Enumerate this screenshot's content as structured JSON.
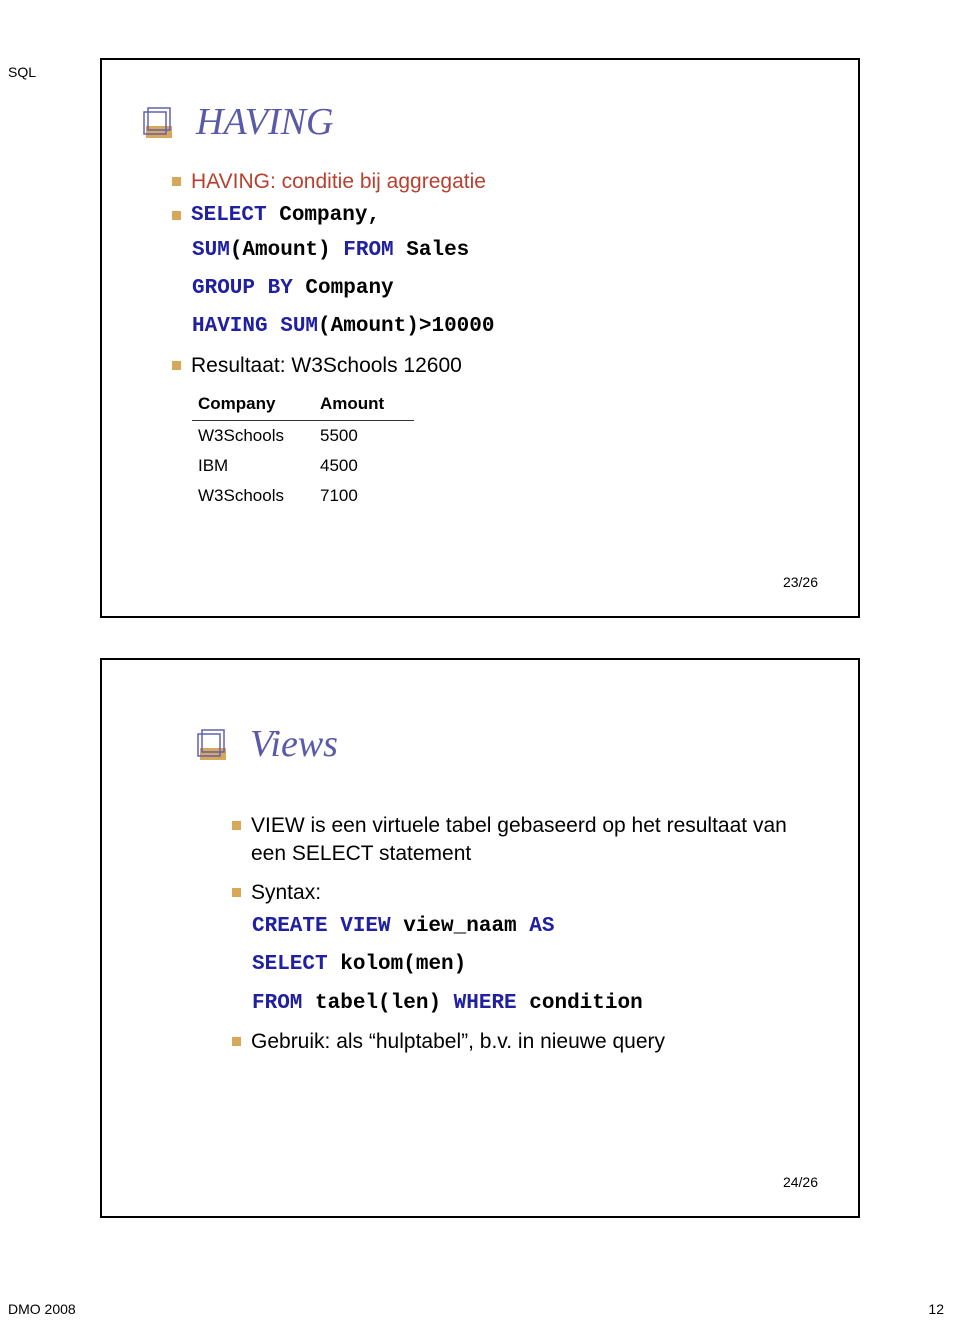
{
  "page_header": "SQL",
  "footer": {
    "left": "DMO 2008",
    "right": "12"
  },
  "slide1": {
    "title": "HAVING",
    "bullet_text": "HAVING: conditie bij aggregatie",
    "code": {
      "kw_select": "SELECT",
      "company": " Company,",
      "kw_sum": "SUM",
      "amount_from": "(Amount)",
      "kw_from": " FROM",
      "sales": " Sales",
      "kw_group_by": "GROUP BY",
      "company2": " Company",
      "kw_having": "HAVING",
      "kw_sum2": " SUM",
      "amount_cond": "(Amount)>10000"
    },
    "result_text": "Resultaat: W3Schools 12600",
    "table": {
      "headers": [
        "Company",
        "Amount"
      ],
      "rows": [
        [
          "W3Schools",
          "5500"
        ],
        [
          "IBM",
          "4500"
        ],
        [
          "W3Schools",
          "7100"
        ]
      ]
    },
    "slide_num": "23/26"
  },
  "slide2": {
    "title": "Views",
    "bullet1": "VIEW is een virtuele tabel gebaseerd op het resultaat van een SELECT statement",
    "syntax_label": "Syntax:",
    "code": {
      "kw_create_view": "CREATE VIEW",
      "view_naam": " view_naam",
      "kw_as": " AS",
      "kw_select": "SELECT",
      "kolom": " kolom(men)",
      "kw_from": "FROM",
      "tabel": " tabel(len)",
      "kw_where": " WHERE",
      "condition": " condition"
    },
    "bullet3": "Gebruik: als “hulptabel”, b.v. in nieuwe query",
    "slide_num": "24/26"
  }
}
